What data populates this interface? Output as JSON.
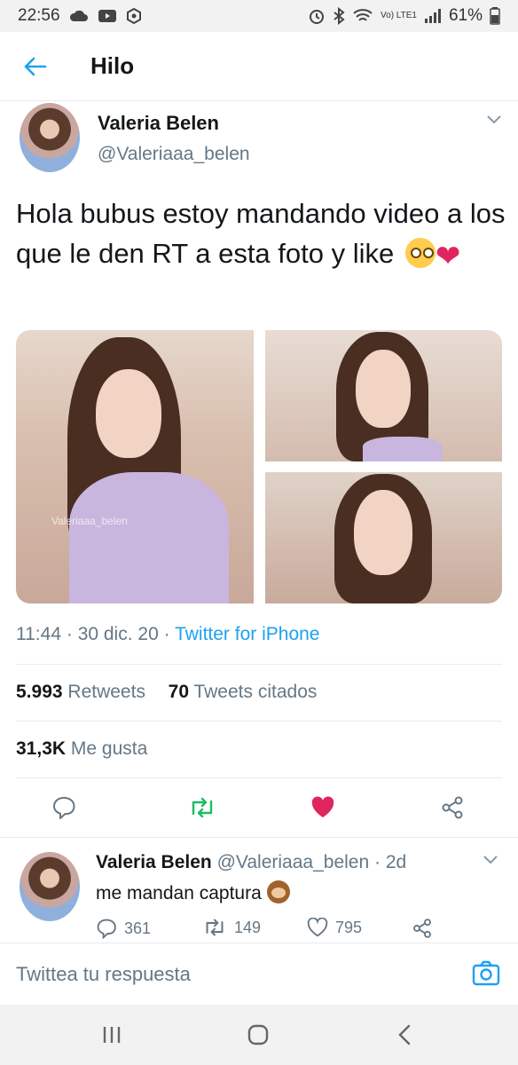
{
  "status_bar": {
    "time": "22:56",
    "battery": "61%",
    "network": "Vo) LTE1"
  },
  "header": {
    "title": "Hilo"
  },
  "tweet": {
    "name": "Valeria Belen",
    "handle": "@Valeriaaa_belen",
    "text": "Hola bubus estoy mandando video a los que le den RT a esta foto y like",
    "emoji": [
      "face-with-rolling-eyes",
      "red-heart"
    ],
    "watermark": "Valeriaaa_belen",
    "time": "11:44",
    "date": "30 dic. 20",
    "source": "Twitter for iPhone",
    "retweets": "5.993",
    "retweets_label": "Retweets",
    "quotes": "70",
    "quotes_label": "Tweets citados",
    "likes": "31,3K",
    "likes_label": "Me gusta",
    "like_color": "#e0245e",
    "retweet_color": "#17bf63"
  },
  "reply": {
    "name": "Valeria Belen",
    "handle": "@Valeriaaa_belen",
    "age": "2d",
    "text": "me mandan captura",
    "emoji": "see-no-evil-monkey",
    "replies": "361",
    "retweets": "149",
    "likes": "795"
  },
  "compose": {
    "placeholder": "Twittea tu respuesta"
  },
  "accent": "#1da1f2"
}
